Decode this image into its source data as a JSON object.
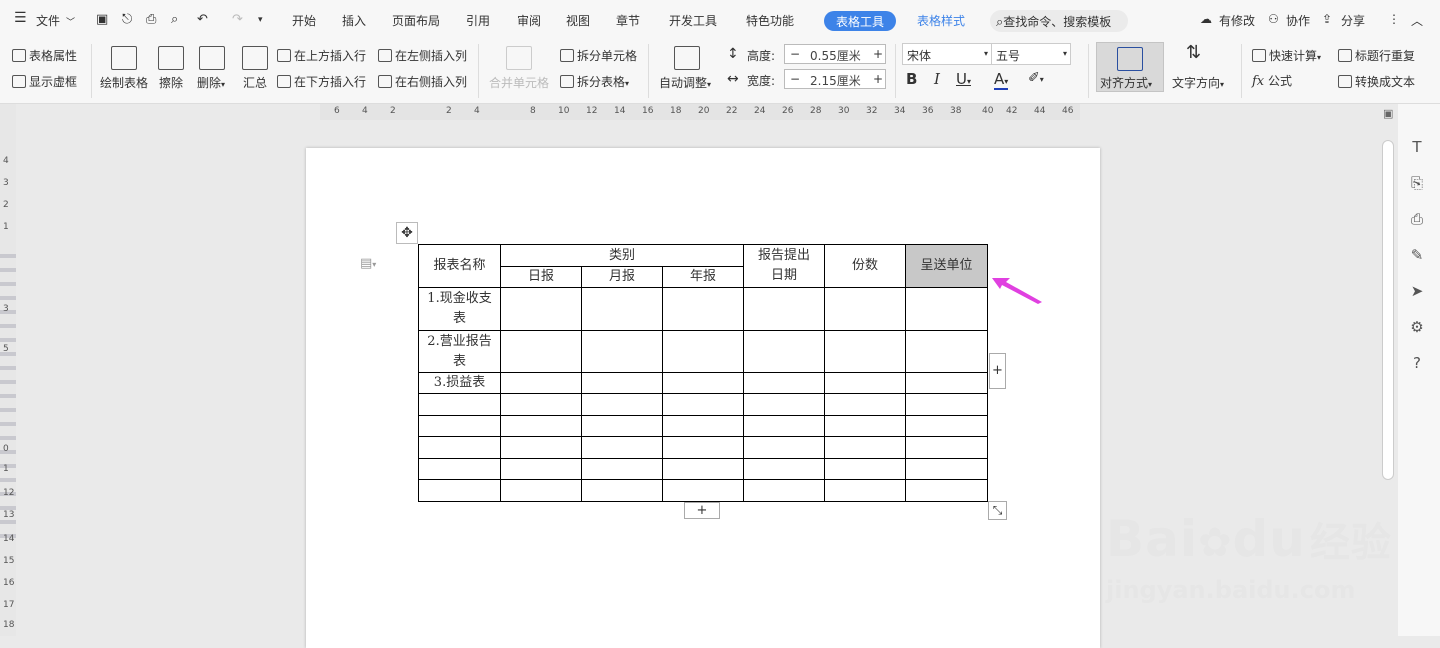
{
  "menubar": {
    "file": "文件",
    "tabs": [
      "开始",
      "插入",
      "页面布局",
      "引用",
      "审阅",
      "视图",
      "章节",
      "开发工具",
      "特色功能"
    ],
    "active_tab": "表格工具",
    "style_tab": "表格样式",
    "search": "查找命令、搜索模板",
    "modified": "有修改",
    "collab": "协作",
    "share": "分享"
  },
  "toolbar": {
    "table_props": "表格属性",
    "show_gridlines": "显示虚框",
    "draw_table": "绘制表格",
    "eraser": "擦除",
    "delete": "删除",
    "summary": "汇总",
    "insert_above": "在上方插入行",
    "insert_below": "在下方插入行",
    "insert_left": "在左侧插入列",
    "insert_right": "在右侧插入列",
    "merge_cells": "合并单元格",
    "split_cells": "拆分单元格",
    "split_table": "拆分表格",
    "autofit": "自动调整",
    "height_label": "高度:",
    "height_value": "0.55厘米",
    "width_label": "宽度:",
    "width_value": "2.15厘米",
    "font_name": "宋体",
    "font_size": "五号",
    "bold": "B",
    "italic": "I",
    "underline": "U",
    "font_color": "A",
    "align": "对齐方式",
    "text_direction": "文字方向",
    "quick_calc": "快速计算",
    "repeat_header": "标题行重复",
    "formula": "公式",
    "convert_text": "转换成文本",
    "spin_minus": "−",
    "spin_plus": "+"
  },
  "ruler": {
    "labels": [
      "6",
      "4",
      "2",
      "2",
      "4",
      "8",
      "10",
      "12",
      "14",
      "16",
      "18",
      "20",
      "22",
      "24",
      "26",
      "28",
      "30",
      "32",
      "34",
      "36",
      "38",
      "40",
      "42",
      "44",
      "46"
    ]
  },
  "vruler": {
    "labels": [
      "4",
      "3",
      "2",
      "1",
      "3",
      "5",
      "0",
      "1",
      "12",
      "13",
      "14",
      "15",
      "16",
      "17",
      "18"
    ]
  },
  "table": {
    "header": {
      "name": "报表名称",
      "category": "类别",
      "daily": "日报",
      "monthly": "月报",
      "yearly": "年报",
      "date": "报告提出日期",
      "copies": "份数",
      "recipient": "呈送单位"
    },
    "rows": [
      "1.现金收支表",
      "2.营业报告表",
      "3.损益表",
      "",
      "",
      "",
      "",
      ""
    ]
  },
  "table_controls": {
    "add_row": "+",
    "add_col": "+"
  },
  "sidebar_icons": [
    "T",
    "⎘",
    "⎙",
    "✎",
    "➤",
    "⚙",
    "?"
  ],
  "watermark": {
    "brand": "Bai",
    "brand2": "du",
    "cn": "经验",
    "url": "jingyan.baidu.com"
  },
  "colors": {
    "accent": "#3d83e8",
    "arrow": "#e040e0",
    "selected_cell": "#c8c8c8"
  }
}
